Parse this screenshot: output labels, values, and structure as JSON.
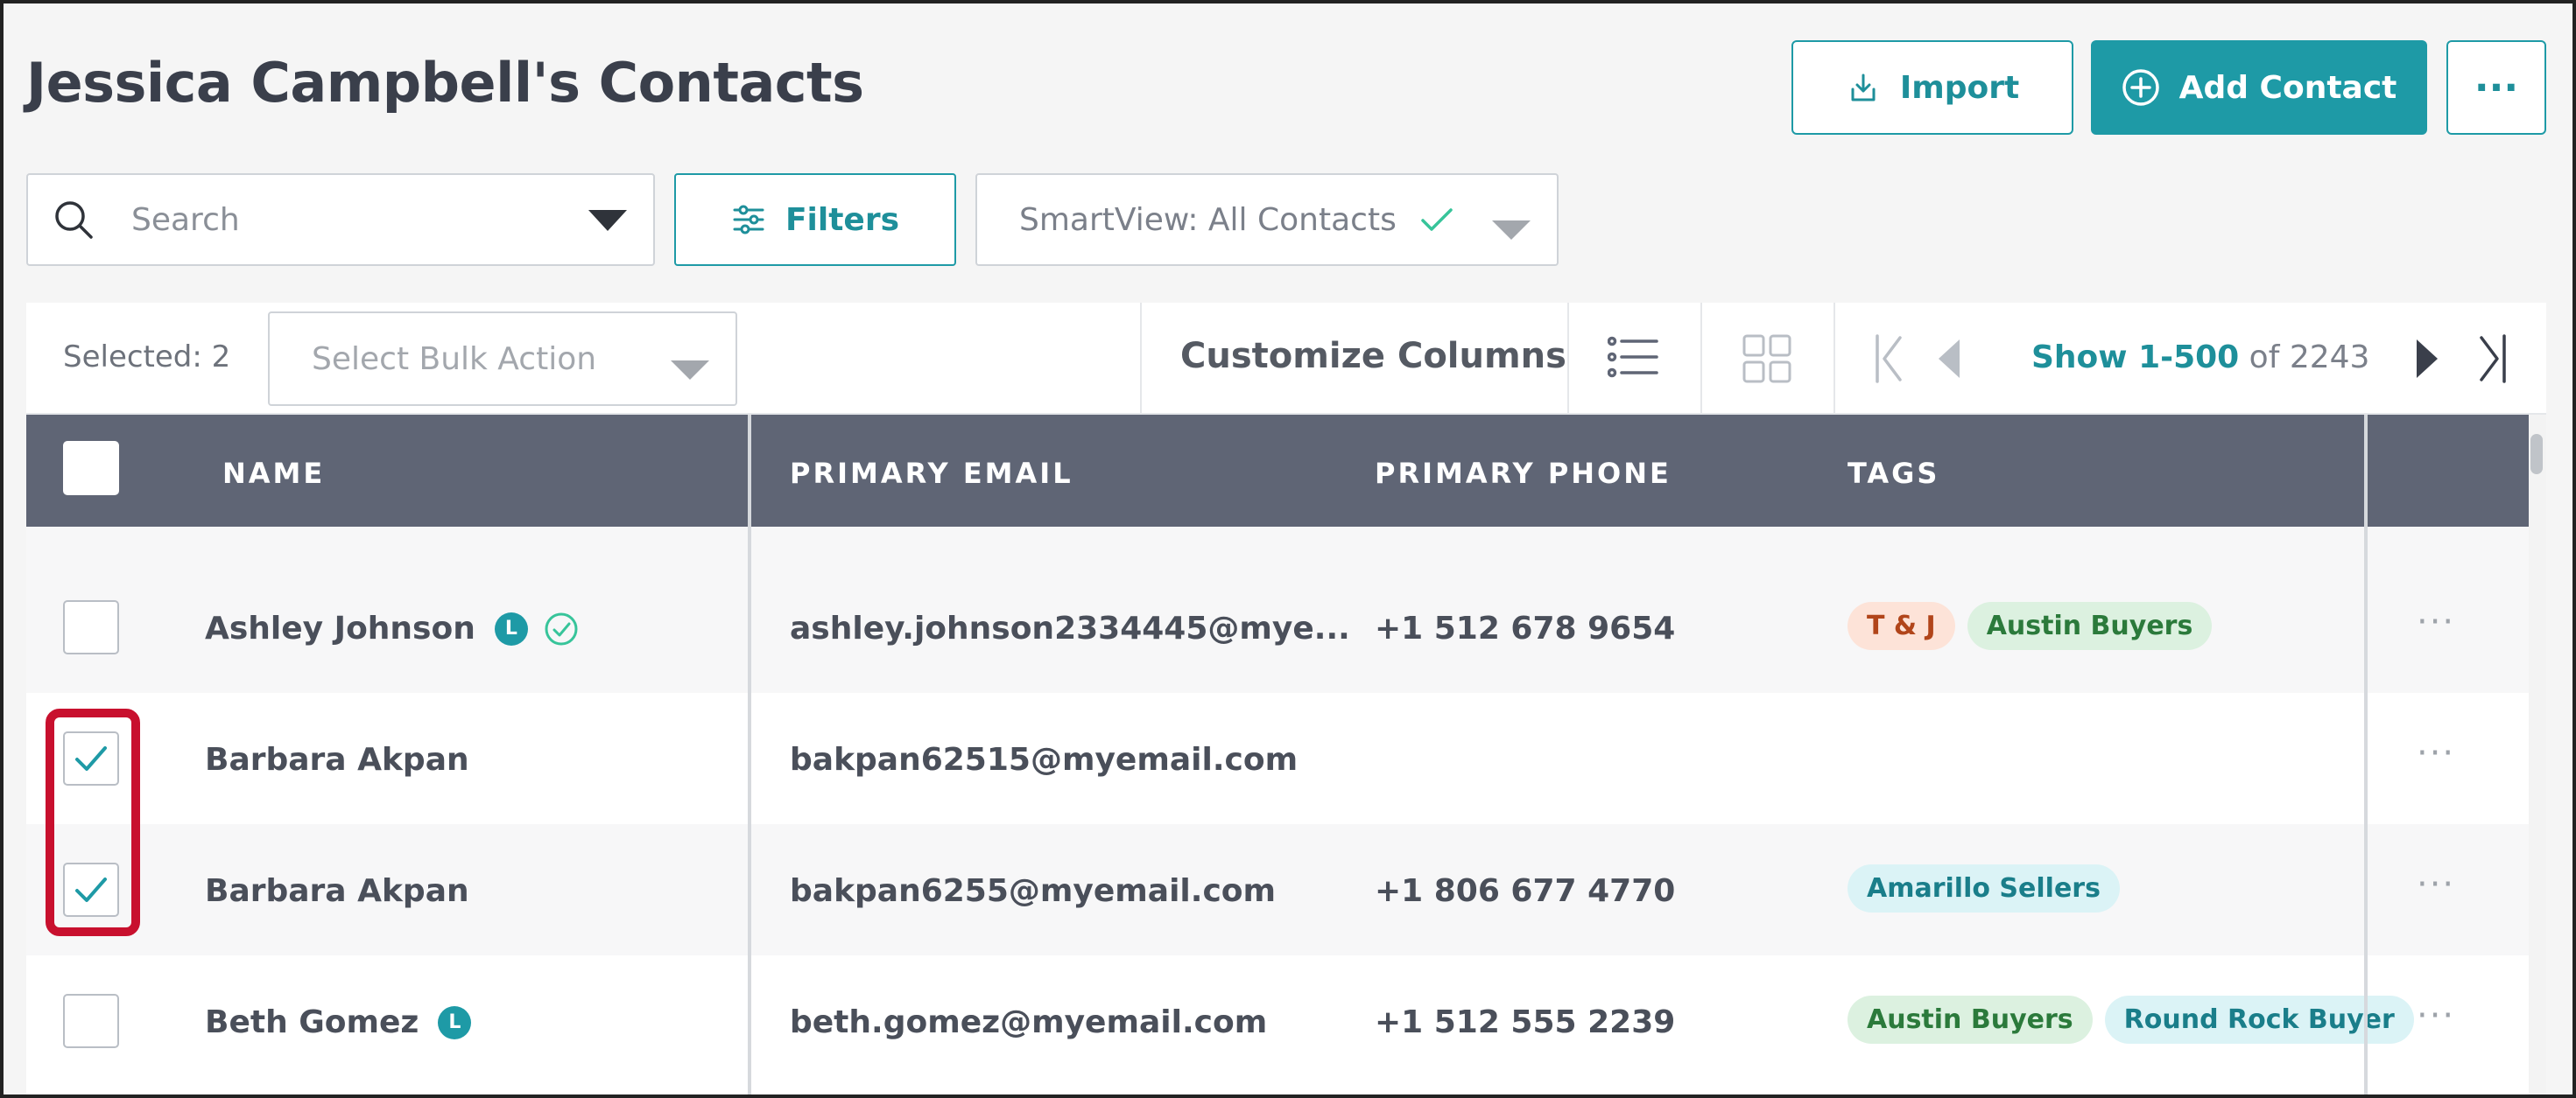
{
  "header": {
    "title": "Jessica Campbell's Contacts",
    "import_label": "Import",
    "add_contact_label": "Add Contact",
    "more_label": "···"
  },
  "search": {
    "placeholder": "Search",
    "filters_label": "Filters",
    "smartview_label": "SmartView: All Contacts"
  },
  "toolbar": {
    "selected_label": "Selected: 2",
    "bulk_action_placeholder": "Select Bulk Action",
    "customize_label": "Customize Columns",
    "pager_range": "Show 1-500",
    "pager_total": "of 2243"
  },
  "table": {
    "columns": [
      "NAME",
      "PRIMARY EMAIL",
      "PRIMARY PHONE",
      "TAGS"
    ],
    "rows": [
      {
        "name": "Ashley Johnson",
        "lead_badge": "L",
        "verified": true,
        "checked": false,
        "email": "ashley.johnson2334445@mye...",
        "phone": "+1 512 678 9654",
        "tags": [
          {
            "label": "T & J",
            "bg": "#fde3d8",
            "fg": "#b1451a"
          },
          {
            "label": "Austin Buyers",
            "bg": "#dcf1e0",
            "fg": "#2b7a3b"
          }
        ]
      },
      {
        "name": "Barbara Akpan",
        "lead_badge": "",
        "verified": false,
        "checked": true,
        "email": "bakpan62515@myemail.com",
        "phone": "",
        "tags": []
      },
      {
        "name": "Barbara Akpan",
        "lead_badge": "",
        "verified": false,
        "checked": true,
        "email": "bakpan6255@myemail.com",
        "phone": "+1 806 677 4770",
        "tags": [
          {
            "label": "Amarillo Sellers",
            "bg": "#dbf3f6",
            "fg": "#1a7e8a"
          }
        ]
      },
      {
        "name": "Beth Gomez",
        "lead_badge": "L",
        "verified": false,
        "checked": false,
        "email": "beth.gomez@myemail.com",
        "phone": "+1 512 555 2239",
        "tags": [
          {
            "label": "Austin Buyers",
            "bg": "#dcf1e0",
            "fg": "#2b7a3b"
          },
          {
            "label": "Round Rock Buyer",
            "bg": "#dbf3f6",
            "fg": "#1a7e8a"
          }
        ]
      }
    ],
    "row_more_label": "···"
  },
  "colors": {
    "accent": "#1e9aa6",
    "header_bg": "#5f6575",
    "highlight": "#c8102e"
  },
  "icons": {
    "import": "download-icon",
    "add": "plus-circle-icon",
    "search": "search-icon",
    "filters": "sliders-icon",
    "smartview_check": "check-icon",
    "list_view": "list-view-icon",
    "grid_view": "grid-view-icon",
    "first": "first-page-icon",
    "prev": "prev-page-icon",
    "next": "next-page-icon",
    "last": "last-page-icon"
  }
}
